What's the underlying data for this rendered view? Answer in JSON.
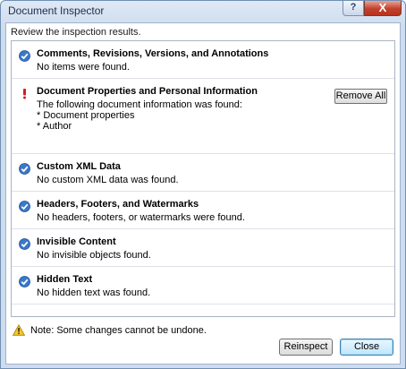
{
  "window": {
    "title": "Document Inspector"
  },
  "titlebar": {
    "help_label": "?",
    "close_label": "X"
  },
  "subtitle": "Review the inspection results.",
  "items": [
    {
      "status": "ok",
      "title": "Comments, Revisions, Versions, and Annotations",
      "lines": [
        "No items were found."
      ]
    },
    {
      "status": "warning",
      "title": "Document Properties and Personal Information",
      "lines": [
        "The following document information was found:",
        "* Document properties",
        "* Author"
      ],
      "action_label": "Remove All"
    },
    {
      "status": "ok",
      "title": "Custom XML Data",
      "lines": [
        "No custom XML data was found."
      ]
    },
    {
      "status": "ok",
      "title": "Headers, Footers, and Watermarks",
      "lines": [
        "No headers, footers, or watermarks were found."
      ]
    },
    {
      "status": "ok",
      "title": "Invisible Content",
      "lines": [
        "No invisible objects found."
      ]
    },
    {
      "status": "ok",
      "title": "Hidden Text",
      "lines": [
        "No hidden text was found."
      ]
    }
  ],
  "note": "Note: Some changes cannot be undone.",
  "buttons": {
    "reinspect": "Reinspect",
    "close": "Close"
  },
  "colors": {
    "check": "#3a78c8",
    "warning": "#d21e1e",
    "accent_border": "#3c7fb1"
  }
}
